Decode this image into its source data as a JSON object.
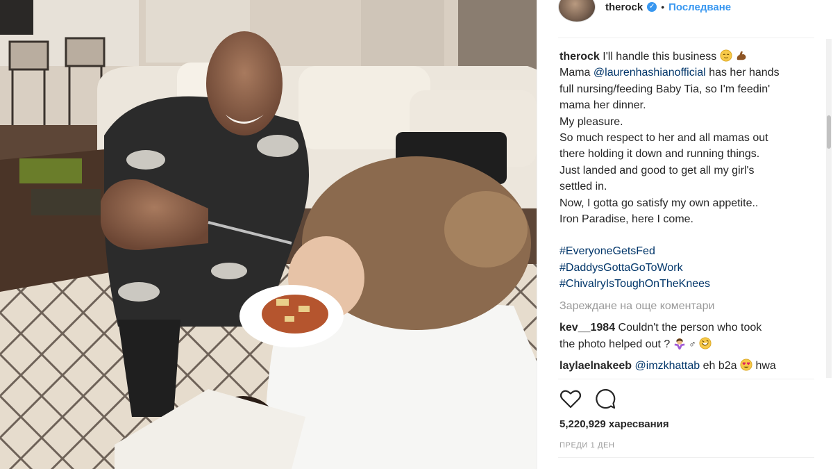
{
  "post": {
    "username": "therock",
    "verified_icon": "verified-badge-icon",
    "separator": "•",
    "follow_label": "Последване"
  },
  "caption": {
    "username": "therock",
    "lines": [
      "I'll handle this business",
      "Mama",
      "@laurenhashianofficial",
      "has her hands",
      "full nursing/feeding Baby Tia, so I'm feedin'",
      "mama her dinner.",
      "My pleasure.",
      "So much respect to her and all mamas out",
      "there holding it down and running things.",
      "Just landed and good to get all my girl's",
      "settled in.",
      "Now, I gotta go satisfy my own appetite..",
      "Iron Paradise, here I come."
    ],
    "hashtags": [
      "#EveryoneGetsFed",
      "#DaddysGottaGoToWork",
      "#ChivalryIsToughOnTheKnees"
    ],
    "emojis": [
      "relieved-face-icon",
      "flexed-biceps-icon"
    ]
  },
  "load_more_label": "Зареждане на още коментари",
  "comments": [
    {
      "username": "kev__1984",
      "text": "Couldn't the person who took",
      "text2": "the photo helped out ?",
      "emojis": [
        "woman-shrugging-icon",
        "rolling-laughing-icon"
      ]
    },
    {
      "username": "laylaelnakeeb",
      "mention": "@imzkhattab",
      "text": "eh b2a",
      "after": "hwa",
      "emojis": [
        "heart-eyes-icon"
      ]
    }
  ],
  "actions": {
    "like_icon": "heart-icon",
    "comment_icon": "comment-bubble-icon"
  },
  "likes_text": "5,220,929 харесвания",
  "timestamp": "ПРЕДИ 1 ДЕН",
  "colors": {
    "link": "#003569",
    "follow": "#3897f0",
    "muted": "#999999",
    "text": "#262626"
  }
}
